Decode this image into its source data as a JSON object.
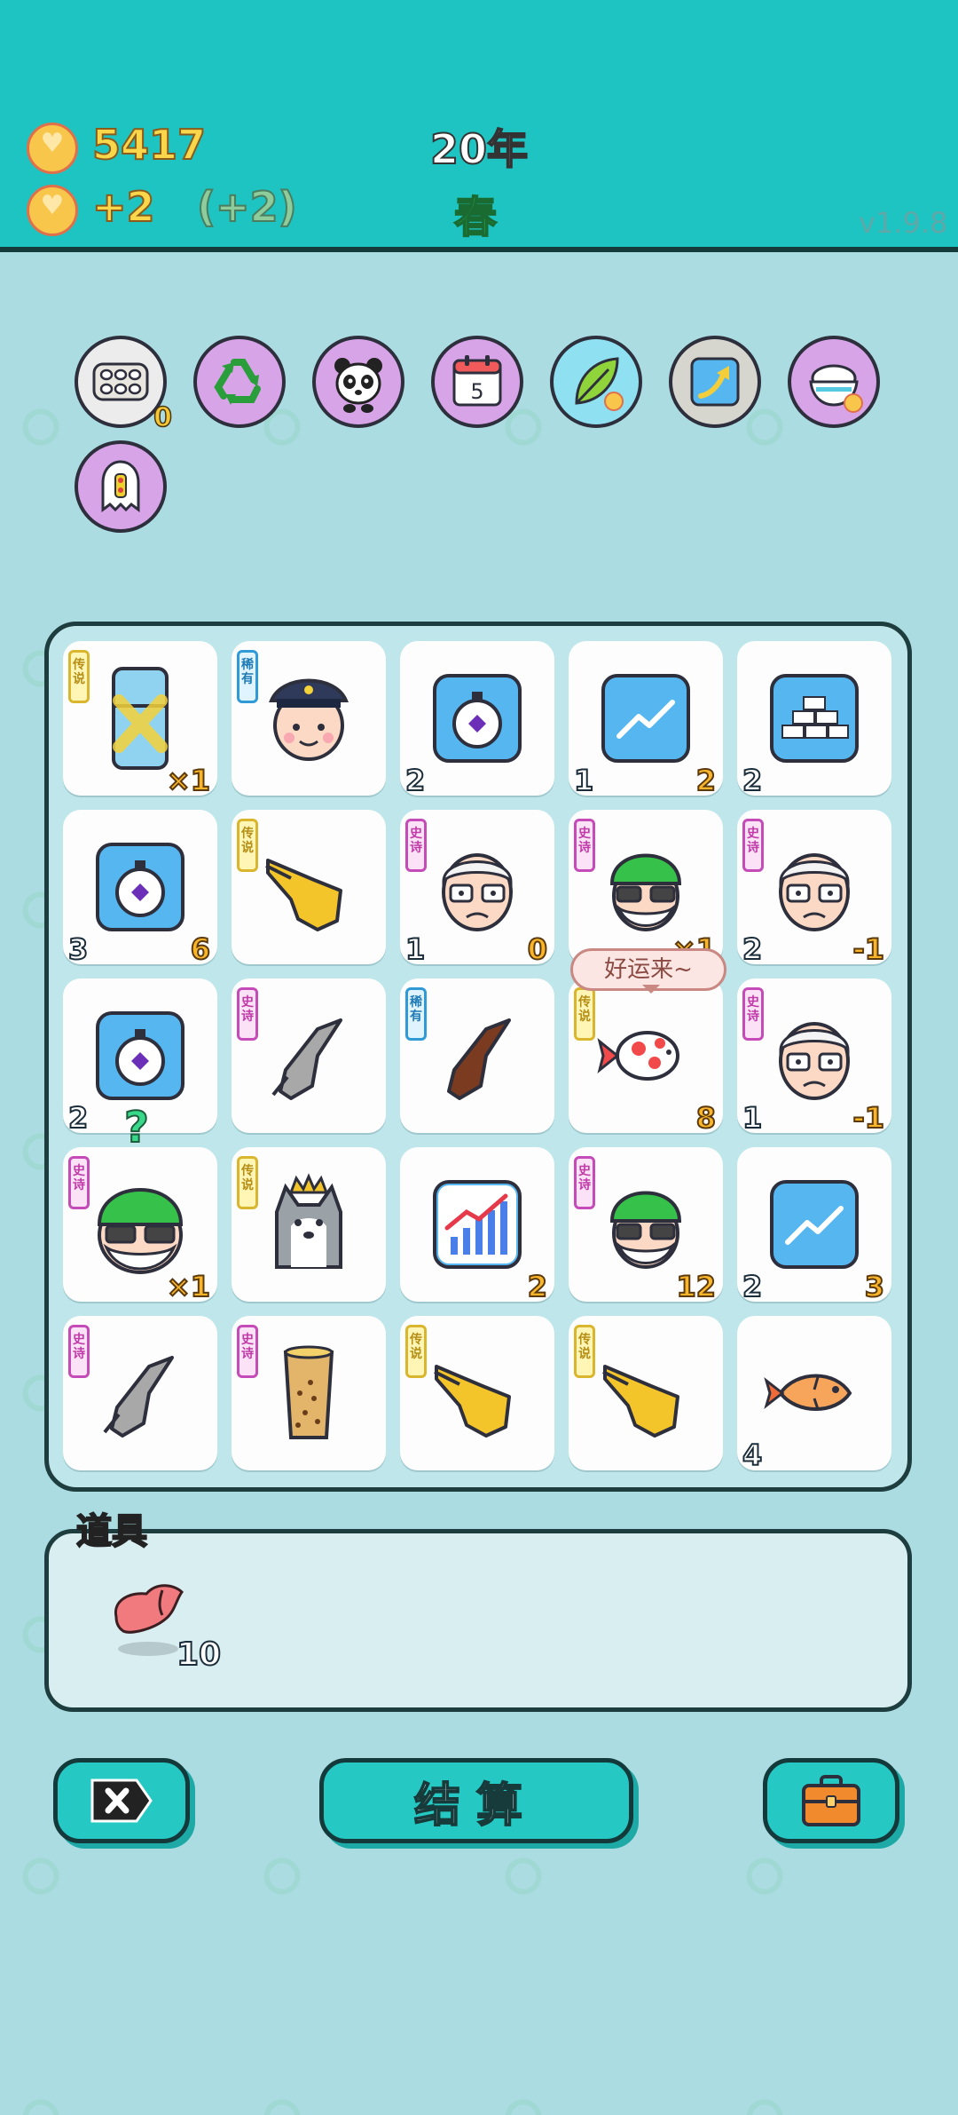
{
  "header": {
    "coins": "5417",
    "income": "+2",
    "income_bonus": "(+2)",
    "year": "20年",
    "season": "春",
    "version": "v1.9.8"
  },
  "relics": [
    {
      "name": "egg-tray",
      "count": "0"
    },
    {
      "name": "recycle"
    },
    {
      "name": "panda"
    },
    {
      "name": "calendar",
      "label": "5"
    },
    {
      "name": "leaf"
    },
    {
      "name": "arrow-card"
    },
    {
      "name": "rice-bowl"
    },
    {
      "name": "ghost"
    }
  ],
  "board": {
    "cells": [
      {
        "icon": "fridge",
        "rarity": "传说",
        "br": "×1"
      },
      {
        "icon": "police-head",
        "rarity": "稀有"
      },
      {
        "icon": "stopwatch",
        "bl": "2"
      },
      {
        "icon": "trend-card",
        "bl": "1",
        "br": "2"
      },
      {
        "icon": "gold-bars",
        "bl": "2"
      },
      {
        "icon": "stopwatch",
        "bl": "3",
        "br": "6"
      },
      {
        "icon": "hand-yellow",
        "rarity": "传说"
      },
      {
        "icon": "old-man",
        "rarity": "史诗",
        "bl": "1",
        "br": "0"
      },
      {
        "icon": "green-hair-man",
        "rarity": "史诗",
        "br": "×1"
      },
      {
        "icon": "old-man",
        "rarity": "史诗",
        "bl": "2",
        "br": "-1"
      },
      {
        "icon": "stopwatch",
        "bl": "2"
      },
      {
        "icon": "hand-gray",
        "rarity": "史诗"
      },
      {
        "icon": "hand-brown",
        "rarity": "稀有"
      },
      {
        "icon": "koi",
        "rarity": "传说",
        "br": "8"
      },
      {
        "icon": "old-man",
        "rarity": "史诗",
        "bl": "1",
        "br": "-1"
      },
      {
        "icon": "green-hair-man-big",
        "rarity": "史诗",
        "br": "×1"
      },
      {
        "icon": "husky-king",
        "rarity": "传说"
      },
      {
        "icon": "chart-card",
        "br": "2"
      },
      {
        "icon": "green-hair-man",
        "rarity": "史诗",
        "br": "12"
      },
      {
        "icon": "trend-card",
        "bl": "2",
        "br": "3"
      },
      {
        "icon": "hand-gray",
        "rarity": "史诗"
      },
      {
        "icon": "milk-tea",
        "rarity": "史诗"
      },
      {
        "icon": "hand-yellow",
        "rarity": "传说"
      },
      {
        "icon": "hand-yellow",
        "rarity": "传说"
      },
      {
        "icon": "fish",
        "bl": "4"
      }
    ],
    "bubble": "好运来~",
    "question_mark": "?"
  },
  "tools": {
    "label": "道具",
    "items": [
      {
        "name": "liver",
        "count": "10"
      }
    ]
  },
  "buttons": {
    "settle": "结算"
  },
  "colors": {
    "topbar": "#1ec4c1",
    "background": "#a9dde3",
    "button": "#25c8c3"
  }
}
